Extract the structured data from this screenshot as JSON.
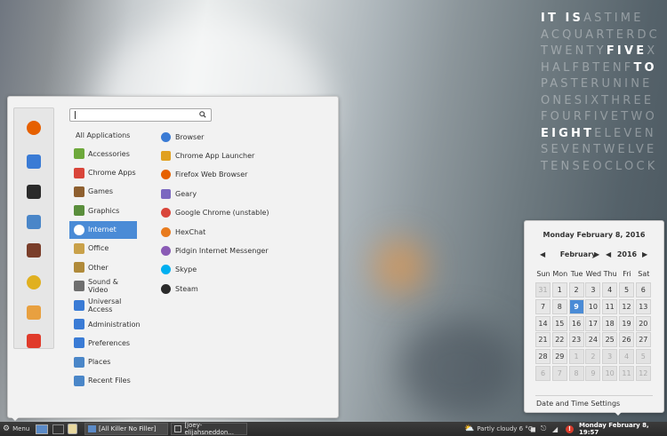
{
  "wordclock": {
    "rows": [
      [
        {
          "t": "IT",
          "h": true
        },
        {
          "t": " ",
          "h": false
        },
        {
          "t": "IS",
          "h": true
        },
        {
          "t": "ASTIME",
          "h": false
        }
      ],
      [
        {
          "t": "ACQUARTERDC",
          "h": false
        }
      ],
      [
        {
          "t": "TWENTY",
          "h": false
        },
        {
          "t": "FIVE",
          "h": true
        },
        {
          "t": "X",
          "h": false
        }
      ],
      [
        {
          "t": "HALFBTEN",
          "h": false
        },
        {
          "t": "F",
          "h": false
        },
        {
          "t": "TO",
          "h": true
        }
      ],
      [
        {
          "t": "PASTERUNINE",
          "h": false
        }
      ],
      [
        {
          "t": "ONESIXTHREE",
          "h": false
        }
      ],
      [
        {
          "t": "FOURFIVETWO",
          "h": false
        }
      ],
      [
        {
          "t": "EIGHT",
          "h": true
        },
        {
          "t": "ELEVEN",
          "h": false
        }
      ],
      [
        {
          "t": "SEVENTWELVE",
          "h": false
        }
      ],
      [
        {
          "t": "TENSEOCLOCK",
          "h": false
        }
      ]
    ]
  },
  "menu": {
    "search": {
      "placeholder": ""
    },
    "favorites": [
      {
        "icon": "firefox-icon",
        "color": "#e66000"
      },
      {
        "icon": "toggle-icon",
        "color": "#3a7bd5"
      },
      {
        "icon": "terminal-icon",
        "color": "#2b2b2b"
      },
      {
        "icon": "folder-icon",
        "color": "#4a86c8"
      },
      {
        "icon": "camera-icon",
        "color": "#7a3e2a"
      },
      {
        "icon": "lightbulb-icon",
        "color": "#e0b020"
      },
      {
        "icon": "user-icon",
        "color": "#e8a040"
      },
      {
        "icon": "power-icon",
        "color": "#e03b2b"
      }
    ],
    "categories": [
      {
        "label": "All Applications",
        "icon": "",
        "color": ""
      },
      {
        "label": "Accessories",
        "icon": "accessories-icon",
        "color": "#6da83b"
      },
      {
        "label": "Chrome Apps",
        "icon": "chrome-icon",
        "color": "#d9453a"
      },
      {
        "label": "Games",
        "icon": "games-icon",
        "color": "#8e5f2f"
      },
      {
        "label": "Graphics",
        "icon": "graphics-icon",
        "color": "#5a8e3c"
      },
      {
        "label": "Internet",
        "icon": "internet-icon",
        "color": "#ffffff"
      },
      {
        "label": "Office",
        "icon": "office-icon",
        "color": "#c9a14a"
      },
      {
        "label": "Other",
        "icon": "other-icon",
        "color": "#b08a3a"
      },
      {
        "label": "Sound & Video",
        "icon": "sound-video-icon",
        "color": "#6e6e6e"
      },
      {
        "label": "Universal Access",
        "icon": "accessibility-icon",
        "color": "#3a7bd5"
      },
      {
        "label": "Administration",
        "icon": "administration-icon",
        "color": "#3a7bd5"
      },
      {
        "label": "Preferences",
        "icon": "preferences-icon",
        "color": "#3a7bd5"
      },
      {
        "label": "Places",
        "icon": "places-icon",
        "color": "#4a86c8"
      },
      {
        "label": "Recent Files",
        "icon": "recent-files-icon",
        "color": "#4a86c8"
      }
    ],
    "selected_category": "Internet",
    "apps": [
      {
        "label": "Browser",
        "icon": "browser-icon",
        "color": "#3a7bd5"
      },
      {
        "label": "Chrome App Launcher",
        "icon": "app-launcher-icon",
        "color": "#e0a020"
      },
      {
        "label": "Firefox Web Browser",
        "icon": "firefox-icon",
        "color": "#e66000"
      },
      {
        "label": "Geary",
        "icon": "geary-icon",
        "color": "#7b68c0"
      },
      {
        "label": "Google Chrome (unstable)",
        "icon": "chrome-icon",
        "color": "#d9453a"
      },
      {
        "label": "HexChat",
        "icon": "hexchat-icon",
        "color": "#e87b1e"
      },
      {
        "label": "Pidgin Internet Messenger",
        "icon": "pidgin-icon",
        "color": "#8a5bb5"
      },
      {
        "label": "Skype",
        "icon": "skype-icon",
        "color": "#00aff0"
      },
      {
        "label": "Steam",
        "icon": "steam-icon",
        "color": "#2a2a2a"
      }
    ]
  },
  "calendar": {
    "header": "Monday February  8, 2016",
    "month": "February",
    "year": "2016",
    "day_names": [
      "Sun",
      "Mon",
      "Tue",
      "Wed",
      "Thu",
      "Fri",
      "Sat"
    ],
    "weeks": [
      [
        [
          "31",
          true
        ],
        [
          "1",
          false
        ],
        [
          "2",
          false
        ],
        [
          "3",
          false
        ],
        [
          "4",
          false
        ],
        [
          "5",
          false
        ],
        [
          "6",
          false
        ]
      ],
      [
        [
          "7",
          false
        ],
        [
          "8",
          false
        ],
        [
          "9",
          false
        ],
        [
          "10",
          false
        ],
        [
          "11",
          false
        ],
        [
          "12",
          false
        ],
        [
          "13",
          false
        ]
      ],
      [
        [
          "14",
          false
        ],
        [
          "15",
          false
        ],
        [
          "16",
          false
        ],
        [
          "17",
          false
        ],
        [
          "18",
          false
        ],
        [
          "19",
          false
        ],
        [
          "20",
          false
        ]
      ],
      [
        [
          "21",
          false
        ],
        [
          "22",
          false
        ],
        [
          "23",
          false
        ],
        [
          "24",
          false
        ],
        [
          "25",
          false
        ],
        [
          "26",
          false
        ],
        [
          "27",
          false
        ]
      ],
      [
        [
          "28",
          false
        ],
        [
          "29",
          false
        ],
        [
          "1",
          true
        ],
        [
          "2",
          true
        ],
        [
          "3",
          true
        ],
        [
          "4",
          true
        ],
        [
          "5",
          true
        ]
      ],
      [
        [
          "6",
          true
        ],
        [
          "7",
          true
        ],
        [
          "8",
          true
        ],
        [
          "9",
          true
        ],
        [
          "10",
          true
        ],
        [
          "11",
          true
        ],
        [
          "12",
          true
        ]
      ]
    ],
    "today": "9",
    "settings_label": "Date and Time Settings"
  },
  "taskbar": {
    "menu_label": "Menu",
    "windows": [
      {
        "label": "[All Killer No Filler]"
      },
      {
        "label": "[joey-elijahsneddon..."
      }
    ],
    "weather": "Partly cloudy 6 °C",
    "clock": "Monday February  8, 19:57"
  }
}
